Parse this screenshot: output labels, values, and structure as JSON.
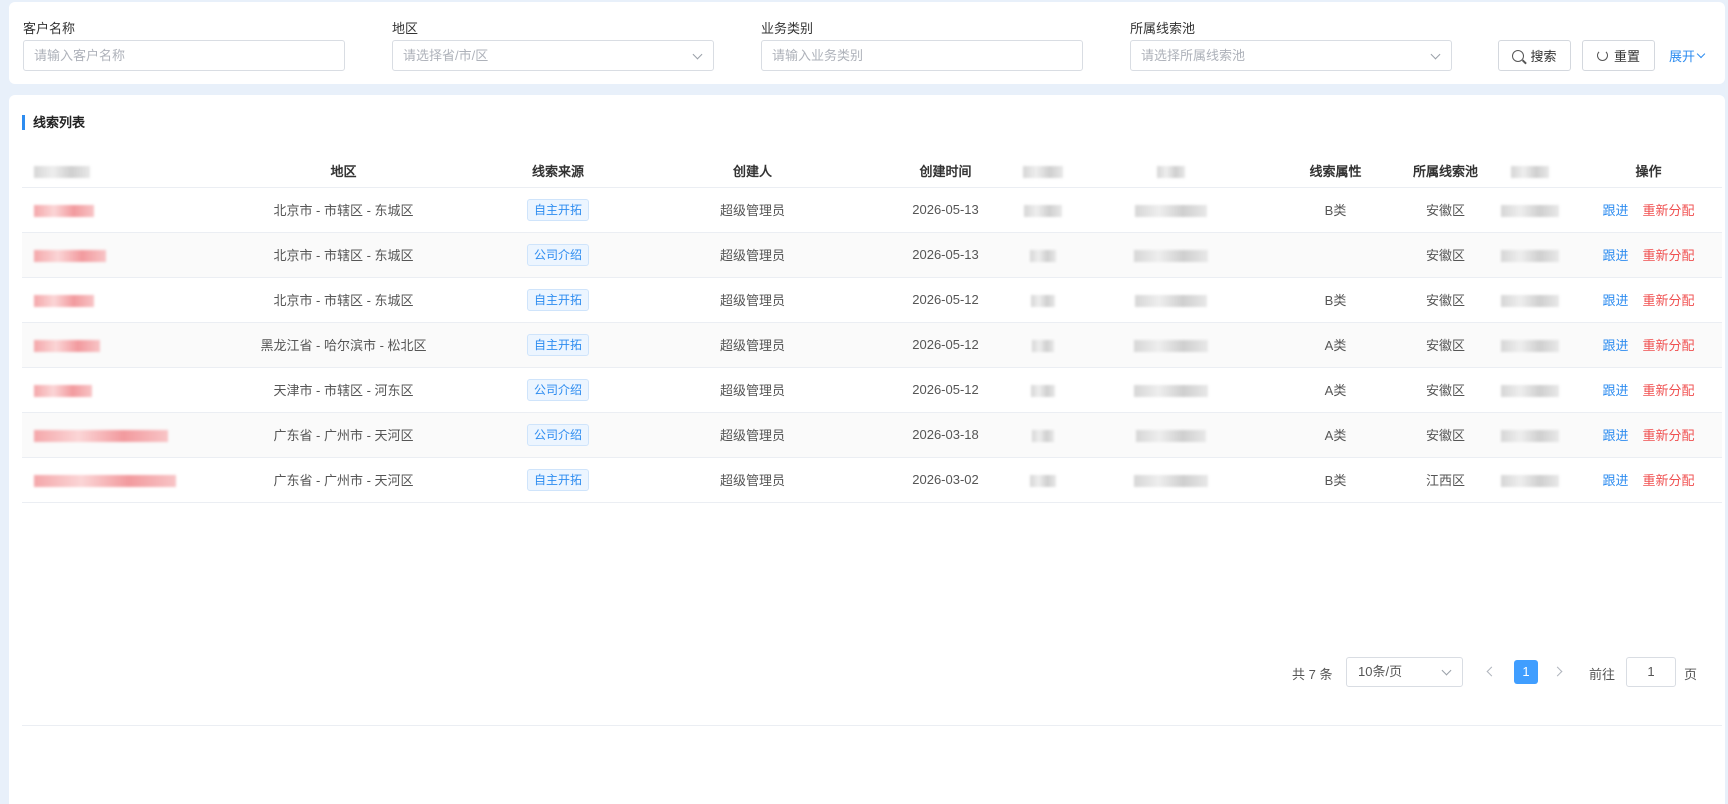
{
  "filters": {
    "customer_name": {
      "label": "客户名称",
      "placeholder": "请输入客户名称"
    },
    "region": {
      "label": "地区",
      "placeholder": "请选择省/市/区"
    },
    "business_type": {
      "label": "业务类别",
      "placeholder": "请输入业务类别"
    },
    "lead_pool": {
      "label": "所属线索池",
      "placeholder": "请选择所属线索池"
    },
    "search_label": "搜索",
    "reset_label": "重置",
    "expand_label": "展开"
  },
  "list": {
    "title": "线索列表",
    "headers": [
      "",
      "地区",
      "线索来源",
      "创建人",
      "创建时间",
      "",
      "",
      "线索属性",
      "所属线索池",
      "",
      "操作"
    ],
    "rows": [
      {
        "region": "北京市 - 市辖区 - 东城区",
        "source": "自主开拓",
        "creator": "超级管理员",
        "created": "2026-05-13",
        "attr": "B类",
        "pool": "安徽区"
      },
      {
        "region": "北京市 - 市辖区 - 东城区",
        "source": "公司介绍",
        "creator": "超级管理员",
        "created": "2026-05-13",
        "attr": "",
        "pool": "安徽区"
      },
      {
        "region": "北京市 - 市辖区 - 东城区",
        "source": "自主开拓",
        "creator": "超级管理员",
        "created": "2026-05-12",
        "attr": "B类",
        "pool": "安徽区"
      },
      {
        "region": "黑龙江省 - 哈尔滨市 - 松北区",
        "source": "自主开拓",
        "creator": "超级管理员",
        "created": "2026-05-12",
        "attr": "A类",
        "pool": "安徽区"
      },
      {
        "region": "天津市 - 市辖区 - 河东区",
        "source": "公司介绍",
        "creator": "超级管理员",
        "created": "2026-05-12",
        "attr": "A类",
        "pool": "安徽区"
      },
      {
        "region": "广东省 - 广州市 - 天河区",
        "source": "公司介绍",
        "creator": "超级管理员",
        "created": "2026-03-18",
        "attr": "A类",
        "pool": "安徽区"
      },
      {
        "region": "广东省 - 广州市 - 天河区",
        "source": "自主开拓",
        "creator": "超级管理员",
        "created": "2026-03-02",
        "attr": "B类",
        "pool": "江西区"
      }
    ],
    "op_follow": "跟进",
    "op_reassign": "重新分配"
  },
  "pagination": {
    "total": "共 7 条",
    "page_size": "10条/页",
    "current": "1",
    "goto_label": "前往",
    "goto_value": "1",
    "page_unit": "页"
  }
}
